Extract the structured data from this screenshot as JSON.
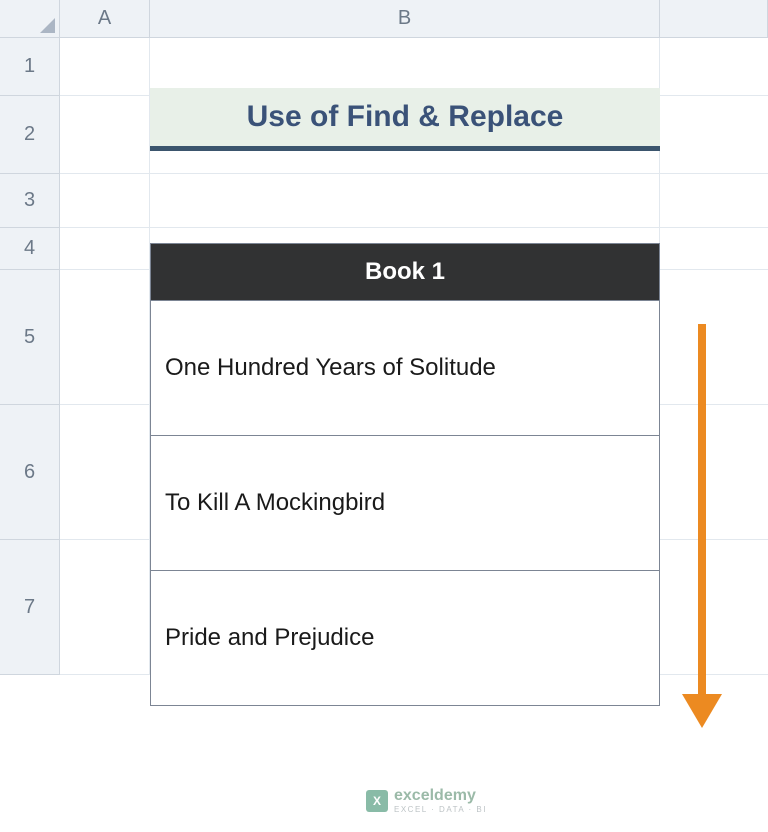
{
  "columns": [
    "A",
    "B"
  ],
  "rows": [
    "1",
    "2",
    "3",
    "4",
    "5",
    "6",
    "7"
  ],
  "title": "Use of Find & Replace",
  "table": {
    "header": "Book 1",
    "rows": [
      "One Hundred Years of Solitude",
      "To Kill A Mockingbird",
      "Pride and Prejudice"
    ]
  },
  "watermark": {
    "brand": "exceldemy",
    "tagline": "EXCEL · DATA · BI",
    "icon": "X"
  }
}
